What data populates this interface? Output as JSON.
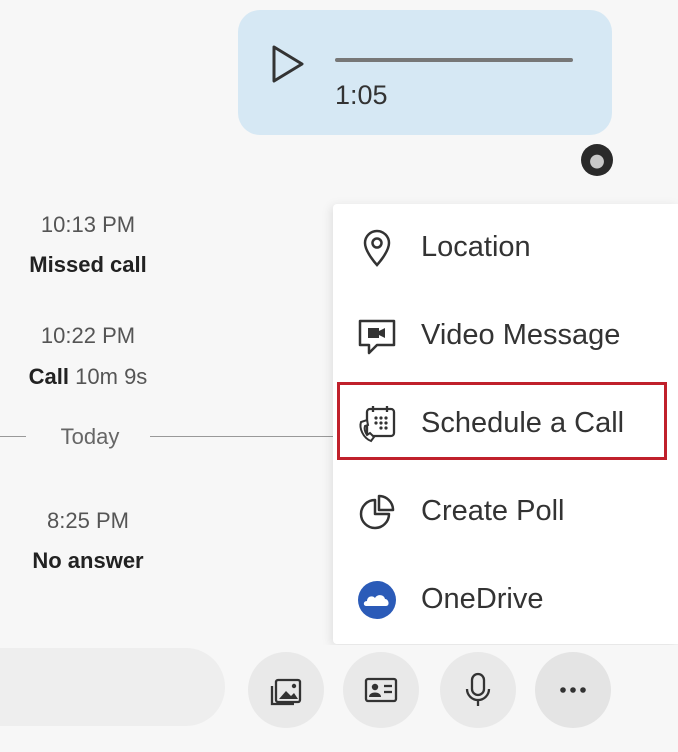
{
  "audio_message": {
    "duration": "1:05",
    "progress": 0
  },
  "call_log": [
    {
      "time": "10:13 PM",
      "label": "Missed call",
      "detail": ""
    },
    {
      "time": "10:22 PM",
      "label": "Call",
      "detail": "10m 9s"
    },
    {
      "time": "8:25 PM",
      "label": "No answer",
      "detail": ""
    }
  ],
  "divider_label": "Today",
  "menu": {
    "items": [
      {
        "label": "Location",
        "icon": "location-pin-icon"
      },
      {
        "label": "Video Message",
        "icon": "video-message-icon"
      },
      {
        "label": "Schedule a Call",
        "icon": "schedule-call-icon",
        "highlighted": true
      },
      {
        "label": "Create Poll",
        "icon": "poll-chart-icon"
      },
      {
        "label": "OneDrive",
        "icon": "onedrive-icon"
      }
    ],
    "highlight_color": "#c0202b"
  },
  "toolbar": {
    "buttons": [
      {
        "icon": "media-gallery-icon"
      },
      {
        "icon": "contact-card-icon"
      },
      {
        "icon": "microphone-icon"
      },
      {
        "icon": "more-options-icon"
      }
    ]
  },
  "colors": {
    "bubble": "#d6e8f4",
    "onedrive": "#2b5bb8"
  }
}
